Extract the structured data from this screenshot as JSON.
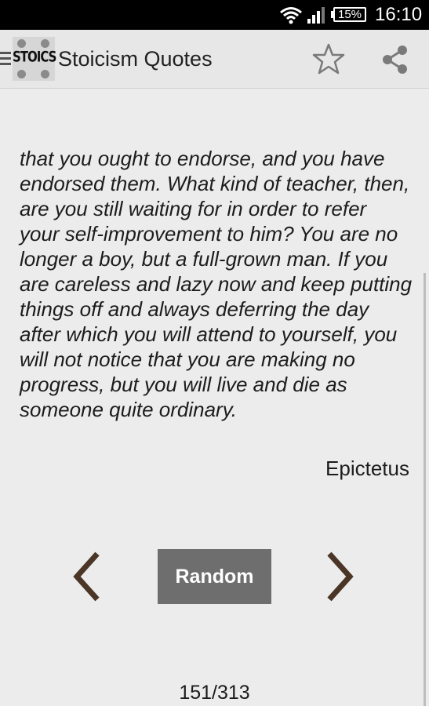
{
  "status_bar": {
    "battery": "15%",
    "time": "16:10",
    "icons": [
      "wifi-icon",
      "signal-icon",
      "battery-icon"
    ]
  },
  "action_bar": {
    "logo_text": "STOICS",
    "title": "Stoicism Quotes",
    "icons": [
      "drawer-icon",
      "star-icon",
      "share-icon"
    ]
  },
  "quote": {
    "lines": [
      "that you ought to endorse, and you have",
      "endorsed them. What kind of teacher, then,",
      "are you still waiting for in order to refer",
      "your self-improvement to him? You are no",
      "longer a boy, but a full-grown man. If you",
      "are careless and lazy now and keep putting",
      "things off and always deferring the day",
      "after which you will attend to yourself, you",
      "will not notice that you are making no",
      "progress, but you will live and die as",
      "someone quite ordinary."
    ],
    "author": "Epictetus"
  },
  "controls": {
    "random_label": "Random",
    "prev_icon": "chevron-left-icon",
    "next_icon": "chevron-right-icon"
  },
  "counter": "151/313",
  "colors": {
    "background": "#ececec",
    "action_bar": "#e7e7e7",
    "random_button": "#6e6e6e",
    "chevron": "#4a3526"
  }
}
